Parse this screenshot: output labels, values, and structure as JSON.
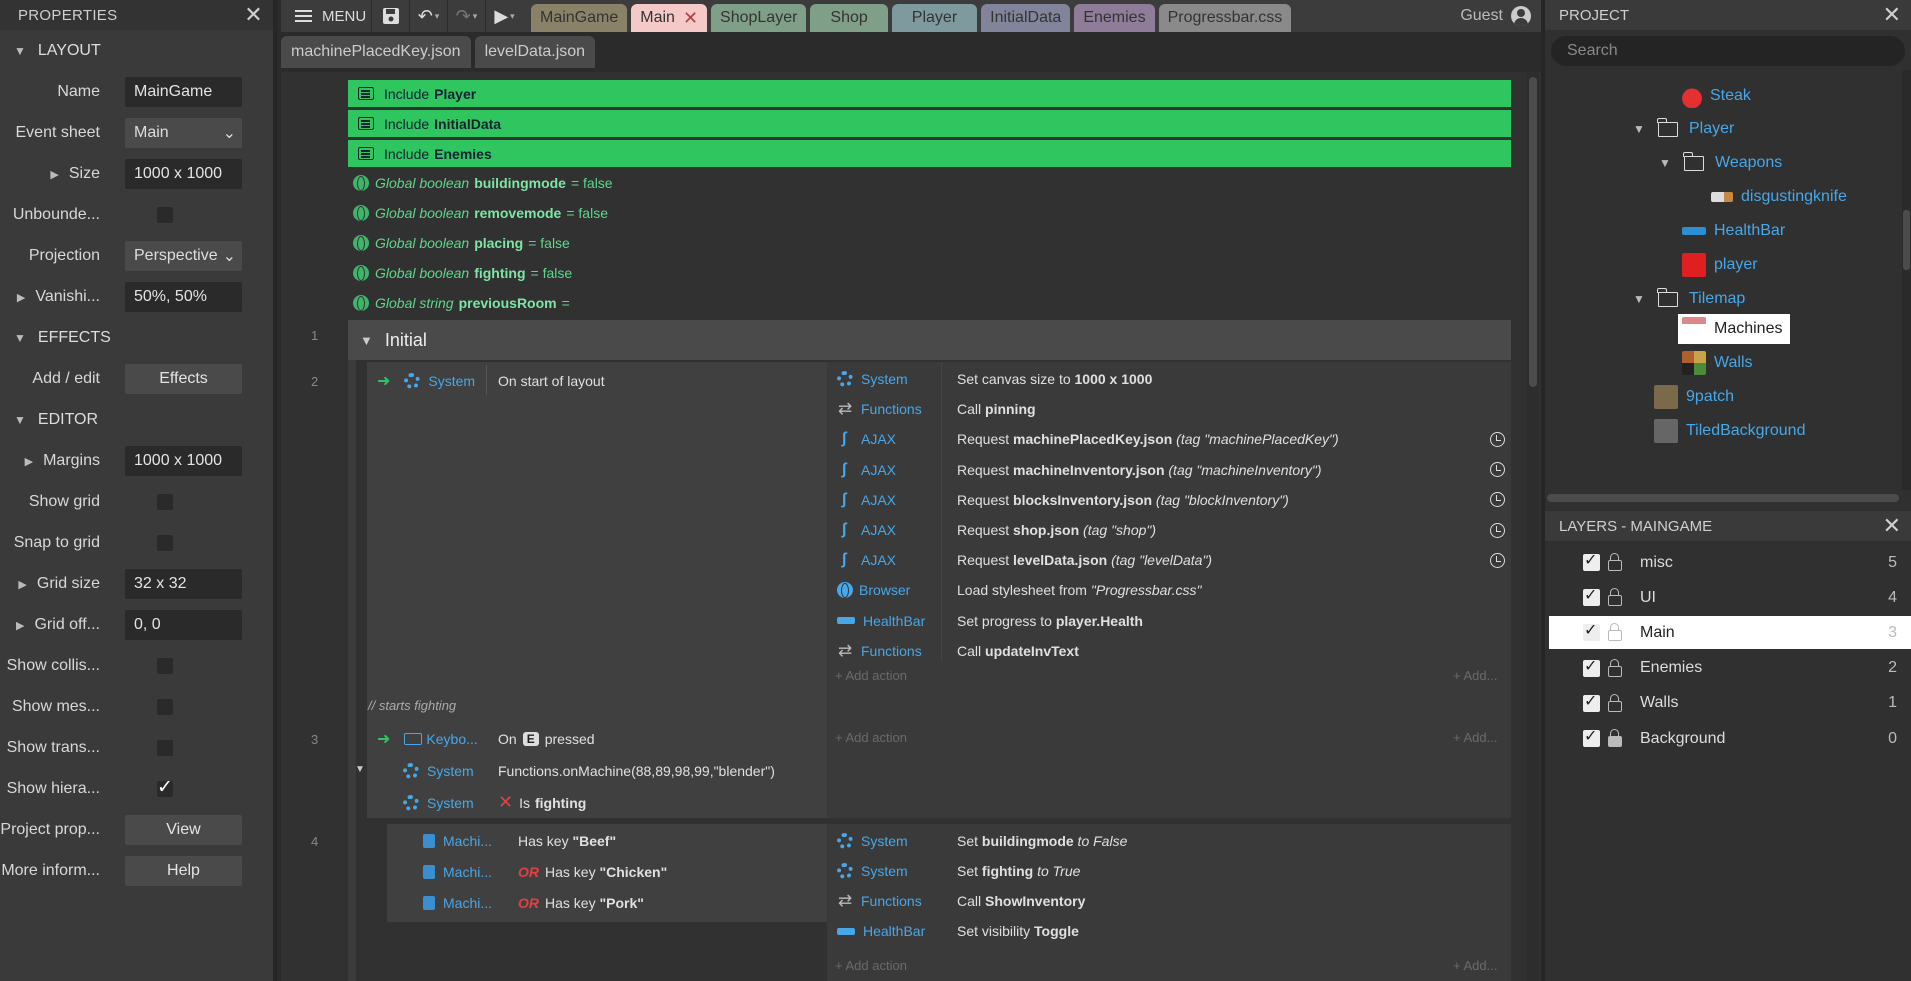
{
  "properties": {
    "title": "PROPERTIES",
    "sections": {
      "layout": "LAYOUT",
      "effects": "EFFECTS",
      "editor": "EDITOR"
    },
    "name_label": "Name",
    "name_value": "MainGame",
    "eventsheet_label": "Event sheet",
    "eventsheet_value": "Main",
    "size_label": "Size",
    "size_value": "1000 x 1000",
    "unbounded_label": "Unbounde...",
    "projection_label": "Projection",
    "projection_value": "Perspective",
    "vanishing_label": "Vanishi...",
    "vanishing_value": "50%, 50%",
    "effects_label": "Add / edit",
    "effects_button": "Effects",
    "margins_label": "Margins",
    "margins_value": "1000 x 1000",
    "showgrid_label": "Show grid",
    "snap_label": "Snap to grid",
    "gridsize_label": "Grid size",
    "gridsize_value": "32 x 32",
    "gridoff_label": "Grid off...",
    "gridoff_value": "0, 0",
    "showcollis_label": "Show collis...",
    "showmes_label": "Show mes...",
    "showtrans_label": "Show trans...",
    "showhiera_label": "Show hiera...",
    "projprop_label": "Project prop...",
    "projprop_button": "View",
    "moreinfo_label": "More inform...",
    "moreinfo_button": "Help"
  },
  "toolbar": {
    "menu_label": "MENU",
    "tabs": [
      "MainGame",
      "Main",
      "ShopLayer",
      "Shop",
      "Player",
      "InitialData",
      "Enemies",
      "Progressbar.css"
    ],
    "tabs_row2": [
      "machinePlacedKey.json",
      "levelData.json"
    ],
    "user": "Guest"
  },
  "sheet": {
    "includes": [
      {
        "pre": "Include",
        "name": "Player"
      },
      {
        "pre": "Include",
        "name": "InitialData"
      },
      {
        "pre": "Include",
        "name": "Enemies"
      }
    ],
    "globals": [
      {
        "type": "Global boolean",
        "name": "buildingmode",
        "rest": "= false"
      },
      {
        "type": "Global boolean",
        "name": "removemode",
        "rest": "= false"
      },
      {
        "type": "Global boolean",
        "name": "placing",
        "rest": "= false"
      },
      {
        "type": "Global boolean",
        "name": "fighting",
        "rest": "= false"
      },
      {
        "type": "Global string",
        "name": "previousRoom",
        "rest": "="
      }
    ],
    "line_numbers": [
      "1",
      "2",
      "3",
      "4"
    ],
    "group_title": "Initial",
    "ev2_cond_obj": "System",
    "ev2_cond_text": "On start of layout",
    "ev2_actions": [
      {
        "obj": "System",
        "pre": "Set canvas size to ",
        "bold": "1000 x 1000",
        "post": ""
      },
      {
        "obj": "Functions",
        "pre": "Call ",
        "bold": "pinning",
        "post": ""
      },
      {
        "obj": "AJAX",
        "pre": "Request ",
        "bold": "machinePlacedKey.json",
        "post": " (tag \"machinePlacedKey\")"
      },
      {
        "obj": "AJAX",
        "pre": "Request ",
        "bold": "machineInventory.json",
        "post": " (tag \"machineInventory\")"
      },
      {
        "obj": "AJAX",
        "pre": "Request ",
        "bold": "blocksInventory.json",
        "post": " (tag \"blockInventory\")"
      },
      {
        "obj": "AJAX",
        "pre": "Request ",
        "bold": "shop.json",
        "post": " (tag \"shop\")"
      },
      {
        "obj": "AJAX",
        "pre": "Request ",
        "bold": "levelData.json",
        "post": " (tag \"levelData\")"
      },
      {
        "obj": "Browser",
        "pre": "Load stylesheet from ",
        "bold": "",
        "post": "\"Progressbar.css\""
      },
      {
        "obj": "HealthBar",
        "pre": "Set progress to ",
        "bold": "player.Health",
        "post": ""
      },
      {
        "obj": "Functions",
        "pre": "Call ",
        "bold": "updateInvText",
        "post": ""
      }
    ],
    "add_action": "+ Add action",
    "add_more": "+ Add...",
    "comment": "//   starts fighting",
    "ev3_conds": [
      {
        "obj": "Keybo...",
        "pre": "On",
        "key": "E",
        "post": "pressed"
      },
      {
        "obj": "System",
        "text": "Functions.onMachine(88,89,98,99,\"blender\")"
      },
      {
        "obj": "System",
        "pre": "Is",
        "bold": "fighting"
      }
    ],
    "ev4_conds": [
      {
        "obj": "Machi...",
        "or": "",
        "pre": "Has key ",
        "bold": "\"Beef\""
      },
      {
        "obj": "Machi...",
        "or": "OR",
        "pre": "Has key ",
        "bold": "\"Chicken\""
      },
      {
        "obj": "Machi...",
        "or": "OR",
        "pre": "Has key ",
        "bold": "\"Pork\""
      }
    ],
    "ev4_actions": [
      {
        "obj": "System",
        "pre": "Set ",
        "bold": "buildingmode",
        "post": " to False"
      },
      {
        "obj": "System",
        "pre": "Set ",
        "bold": "fighting",
        "post": " to True"
      },
      {
        "obj": "Functions",
        "pre": "Call ",
        "bold": "ShowInventory",
        "post": ""
      },
      {
        "obj": "HealthBar",
        "pre": "Set visibility ",
        "bold": "Toggle",
        "post": ""
      }
    ]
  },
  "project": {
    "title": "PROJECT",
    "search_placeholder": "Search",
    "tree": [
      "Steak",
      "Player",
      "Weapons",
      "disgustingknife",
      "HealthBar",
      "player",
      "Tilemap",
      "Machines",
      "Walls",
      "9patch",
      "TiledBackground"
    ]
  },
  "layers": {
    "title": "LAYERS - MAINGAME",
    "items": [
      {
        "name": "misc",
        "count": "5"
      },
      {
        "name": "UI",
        "count": "4"
      },
      {
        "name": "Main",
        "count": "3"
      },
      {
        "name": "Enemies",
        "count": "2"
      },
      {
        "name": "Walls",
        "count": "1"
      },
      {
        "name": "Background",
        "count": "0"
      }
    ]
  }
}
